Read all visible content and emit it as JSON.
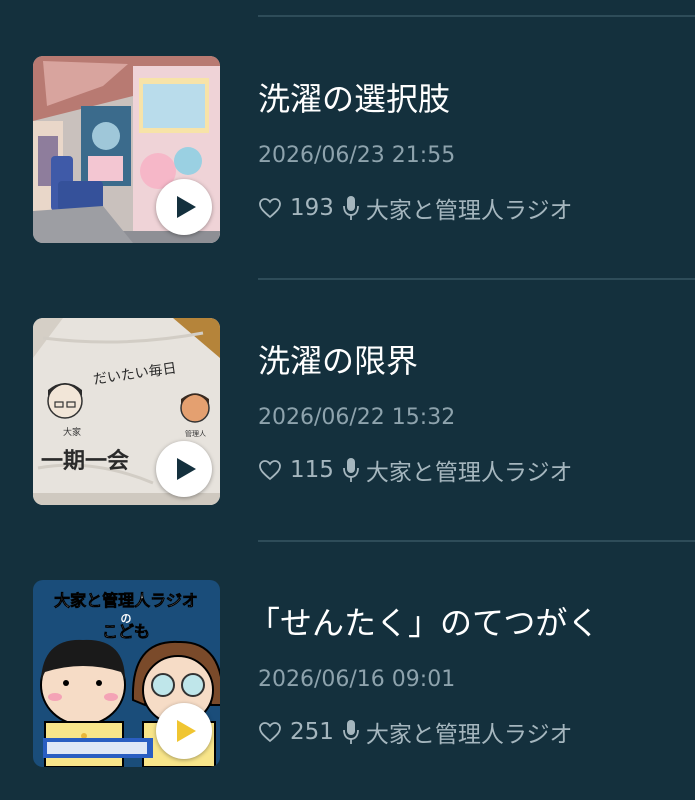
{
  "episodes": [
    {
      "title": "洗濯の選択肢",
      "date": "2026/06/23 21:55",
      "likes": "193",
      "channel": "大家と管理人ラジオ",
      "icons": {
        "like": "heart-outline-icon",
        "channel": "microphone-icon",
        "play": "play-icon"
      }
    },
    {
      "title": "洗濯の限界",
      "date": "2026/06/22 15:32",
      "likes": "115",
      "channel": "大家と管理人ラジオ",
      "thumb_text": [
        "だいたい毎日",
        "一期一会"
      ],
      "icons": {
        "like": "heart-outline-icon",
        "channel": "microphone-icon",
        "play": "play-icon"
      }
    },
    {
      "title": "「せんたく」のてつがく",
      "date": "2026/06/16 09:01",
      "likes": "251",
      "channel": "大家と管理人ラジオ",
      "thumb_text": [
        "大家と管理人ラジオ",
        "の",
        "こども"
      ],
      "icons": {
        "like": "heart-outline-icon",
        "channel": "microphone-icon",
        "play": "play-icon"
      }
    }
  ],
  "colors": {
    "background": "#14303d",
    "divider": "#2e4c59",
    "title": "#ffffff",
    "date": "#8ea3ad",
    "meta": "#a5b6be"
  }
}
